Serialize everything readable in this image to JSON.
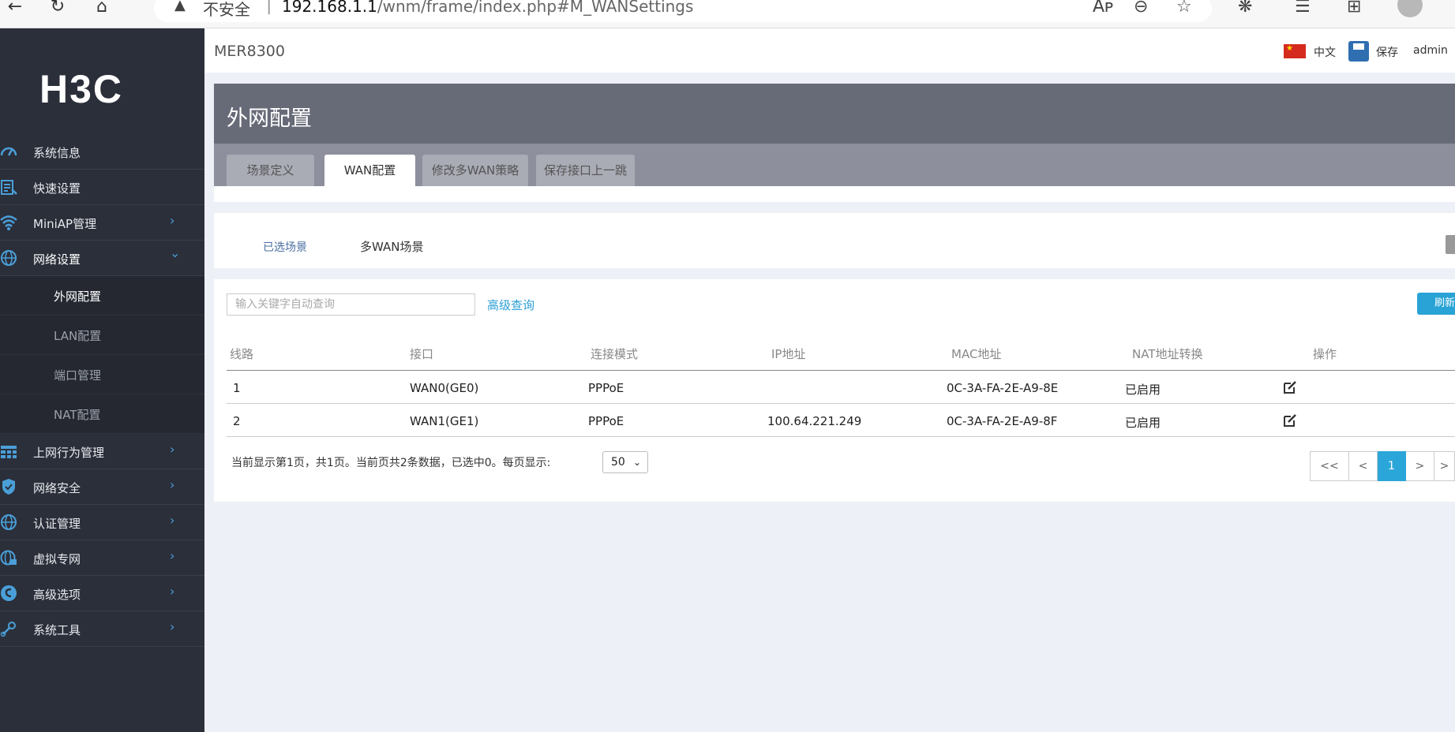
{
  "browser": {
    "insecure_label": "不安全",
    "separator": "|",
    "url_host": "192.168.1.1",
    "url_path": "/wnm/frame/index.php#M_WANSettings"
  },
  "brand": {
    "logo": "H3C"
  },
  "sidebar": {
    "items": [
      {
        "label": "系统信息",
        "icon": "dashboard-icon"
      },
      {
        "label": "快速设置",
        "icon": "quick-setup-icon"
      },
      {
        "label": "MiniAP管理",
        "icon": "wifi-icon",
        "has_children": true
      },
      {
        "label": "网络设置",
        "icon": "globe-icon",
        "expanded": true
      },
      {
        "label": "上网行为管理",
        "icon": "grid-icon",
        "has_children": true
      },
      {
        "label": "网络安全",
        "icon": "shield-icon",
        "has_children": true
      },
      {
        "label": "认证管理",
        "icon": "globe-icon",
        "has_children": true
      },
      {
        "label": "虚拟专网",
        "icon": "globe-lock-icon",
        "has_children": true
      },
      {
        "label": "高级选项",
        "icon": "settings-globe-icon",
        "has_children": true
      },
      {
        "label": "系统工具",
        "icon": "tools-icon",
        "has_children": true
      }
    ],
    "sub_items": [
      {
        "label": "外网配置",
        "active": true
      },
      {
        "label": "LAN配置"
      },
      {
        "label": "端口管理"
      },
      {
        "label": "NAT配置"
      }
    ]
  },
  "header": {
    "device_name": "MER8300",
    "language": "中文",
    "save_label": "保存",
    "user": "admin"
  },
  "page": {
    "title": "外网配置",
    "tabs": [
      {
        "label": "场景定义",
        "active": false
      },
      {
        "label": "WAN配置",
        "active": true
      },
      {
        "label": "修改多WAN策略",
        "active": false
      },
      {
        "label": "保存接口上一跳",
        "active": false
      }
    ]
  },
  "scene": {
    "label": "已选场景",
    "value": "多WAN场景"
  },
  "toolbar": {
    "search_placeholder": "输入关键字自动查询",
    "advanced_query": "高级查询",
    "refresh_label": "刷新"
  },
  "table": {
    "columns": [
      "线路",
      "接口",
      "连接模式",
      "IP地址",
      "MAC地址",
      "NAT地址转换",
      "操作"
    ],
    "rows": [
      {
        "line": "1",
        "interface": "WAN0(GE0)",
        "mode": "PPPoE",
        "ip": "",
        "mac": "0C-3A-FA-2E-A9-8E",
        "nat": "已启用"
      },
      {
        "line": "2",
        "interface": "WAN1(GE1)",
        "mode": "PPPoE",
        "ip": "100.64.221.249",
        "mac": "0C-3A-FA-2E-A9-8F",
        "nat": "已启用"
      }
    ]
  },
  "pagination": {
    "summary": "当前显示第1页，共1页。当前页共2条数据，已选中0。每页显示:",
    "page_size": "50",
    "first": "<<",
    "prev": "<",
    "current": "1",
    "next": ">",
    "last": ">"
  },
  "colors": {
    "sidebar_bg": "#2b2f3a",
    "accent": "#2ba6d8",
    "icon_blue": "#4a9fd8",
    "title_bar": "#676a77",
    "tab_bar": "#8d8f9c"
  }
}
